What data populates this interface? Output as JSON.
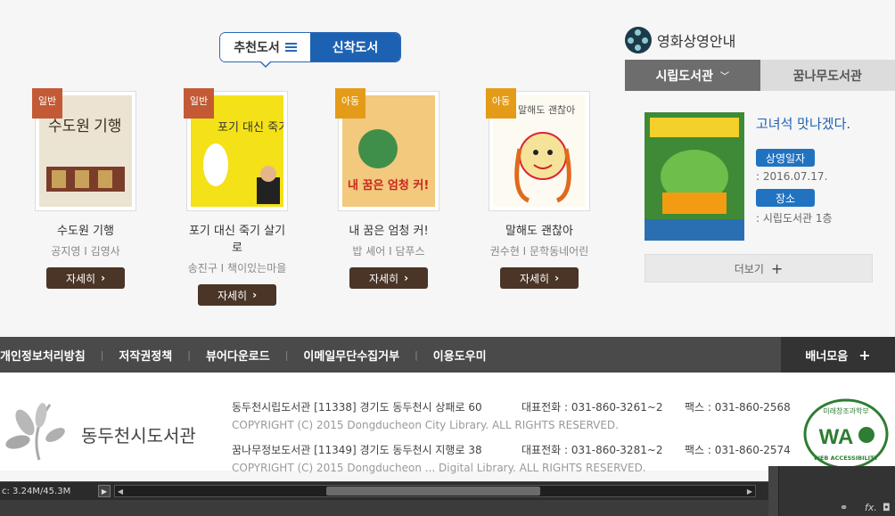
{
  "book_tabs": {
    "recommended": "추천도서",
    "new": "신착도서"
  },
  "books": [
    {
      "badge": "일반",
      "badge_type": "gen",
      "cover_text": "수도원 기행",
      "title": "수도원 기행",
      "meta": "공지영 I 김영사",
      "more": "자세히"
    },
    {
      "badge": "일반",
      "badge_type": "gen",
      "cover_text": "포기 대신 죽기 살기로",
      "title": "포기 대신 죽기 살기로",
      "meta": "송진구 I 책이있는마을",
      "more": "자세히"
    },
    {
      "badge": "아동",
      "badge_type": "kid",
      "cover_text": "내 꿈은 엄청 커!",
      "title": "내 꿈은 엄청 커!",
      "meta": "밥 셰어 I 담푸스",
      "more": "자세히"
    },
    {
      "badge": "아동",
      "badge_type": "kid",
      "cover_text": "말해도 괜찮아",
      "title": "말해도 괜찮아",
      "meta": "권수현 I 문학동네어린",
      "more": "자세히"
    }
  ],
  "movie": {
    "heading": "영화상영안내",
    "tabs": [
      "시립도서관",
      "꿈나무도서관"
    ],
    "title": "고녀석 맛나겠다.",
    "date_label": "상영일자",
    "date": ": 2016.07.17.",
    "place_label": "장소",
    "place": ": 시립도서관 1층",
    "more": "더보기"
  },
  "footer_nav": {
    "items": [
      "개인정보처리방침",
      "저작권정책",
      "뷰어다운로드",
      "이메일무단수집거부",
      "이용도우미"
    ],
    "banner": "배너모음"
  },
  "footer": {
    "org": "동두천시도서관",
    "libs": [
      {
        "addr": "동두천시립도서관 [11338] 경기도 동두천시 상패로 60",
        "phone": "대표전화 : 031-860-3261~2",
        "fax": "팩스 : 031-860-2568",
        "copy": "COPYRIGHT (C) 2015 Dongducheon City Library. ALL RIGHTS RESERVED."
      },
      {
        "addr": "꿈나무정보도서관 [11349] 경기도 동두천시 지행로 38",
        "phone": "대표전화 : 031-860-3281~2",
        "fax": "팩스 : 031-860-2574",
        "copy": "COPYRIGHT (C) 2015 Dongducheon ... Digital Library. ALL RIGHTS RESERVED."
      }
    ],
    "wa_badge": {
      "top": "미래창조과학부",
      "mark": "WA",
      "bottom": "WEB ACCESSIBILITY"
    }
  },
  "statusbar": {
    "mem": "c: 3.24M/45.3M"
  },
  "colors": {
    "accent": "#1d62b2",
    "dark_btn": "#4a3527",
    "nav_bg": "#4a4a4a"
  }
}
